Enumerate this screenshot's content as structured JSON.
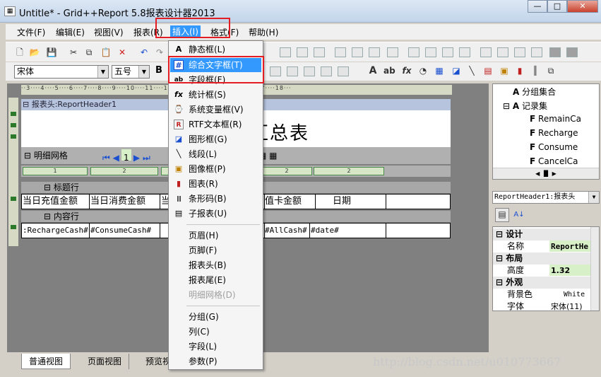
{
  "window": {
    "title": "Untitle* - Grid++Report 5.8报表设计器2013",
    "min": "—",
    "max": "□",
    "close": "✕"
  },
  "menubar": [
    "文件(F)",
    "编辑(E)",
    "视图(V)",
    "报表(R)",
    "插入(I)",
    "格式(F)",
    "帮助(H)"
  ],
  "format_bar": {
    "font": "宋体",
    "size": "五号",
    "bold": "B"
  },
  "canvas": {
    "ruler_text": "··3····4····5····6····7····8····9····10····11····12····13····14····15····16····17····18···",
    "report_header_label": "报表头:ReportHeader1",
    "report_title": "柜台充值汇总表",
    "detail_grid_label": "明细网格",
    "nav_page": "1",
    "column_ruler": [
      "1",
      "2",
      "2",
      "2",
      "2",
      "2",
      "2"
    ],
    "title_row_label": "标题行",
    "title_cells": [
      "当日充值金额",
      "当日消费金额",
      "当",
      "值卡金额",
      "日期"
    ],
    "content_row_label": "内容行",
    "content_cells": [
      ":RechargeCash#",
      "#ConsumeCash#",
      "",
      "#AllCash#",
      "#date#"
    ]
  },
  "insert_menu": {
    "items": [
      {
        "label": "静态框(L)",
        "icon": "A"
      },
      {
        "label": "综合文字框(T)",
        "icon": "#",
        "highlighted": true
      },
      {
        "label": "字段框(F)",
        "icon": "ab"
      },
      {
        "label": "统计框(S)",
        "icon": "fx"
      },
      {
        "label": "系统变量框(V)",
        "icon": "⌚"
      },
      {
        "label": "RTF文本框(R)",
        "icon": "R"
      },
      {
        "label": "图形框(G)",
        "icon": "◪"
      },
      {
        "label": "线段(L)",
        "icon": "╲"
      },
      {
        "label": "图像框(P)",
        "icon": "▣"
      },
      {
        "label": "图表(R)",
        "icon": "▮"
      },
      {
        "label": "条形码(B)",
        "icon": "|||"
      },
      {
        "label": "子报表(U)",
        "icon": "▤"
      },
      {
        "label": "页眉(H)",
        "icon": ""
      },
      {
        "label": "页脚(F)",
        "icon": ""
      },
      {
        "label": "报表头(B)",
        "icon": ""
      },
      {
        "label": "报表尾(E)",
        "icon": ""
      },
      {
        "label": "明细网格(D)",
        "icon": "",
        "disabled": true
      },
      {
        "label": "分组(G)",
        "icon": ""
      },
      {
        "label": "列(C)",
        "icon": ""
      },
      {
        "label": "字段(L)",
        "icon": ""
      },
      {
        "label": "参数(P)",
        "icon": ""
      }
    ]
  },
  "tree": [
    {
      "label": "分组集合",
      "icon": "A"
    },
    {
      "label": "记录集",
      "icon": "A"
    },
    {
      "label": "RemainCa",
      "icon": "F"
    },
    {
      "label": "Recharge",
      "icon": "F"
    },
    {
      "label": "Consume",
      "icon": "F"
    },
    {
      "label": "CancelCa",
      "icon": "F"
    }
  ],
  "object_select": "ReportHeader1:报表头",
  "properties": {
    "design": "设计",
    "name_key": "名称",
    "name_val": "ReportHe",
    "layout": "布局",
    "height_key": "高度",
    "height_val": "1.32",
    "appearance": "外观",
    "bg_key": "背景色",
    "bg_val": "White",
    "font_key": "字体",
    "font_val": "宋体(11)"
  },
  "bottom_tabs": [
    "普通视图",
    "页面视图",
    "预览视"
  ],
  "watermark": "http://blog.csdn.net/u010773667"
}
